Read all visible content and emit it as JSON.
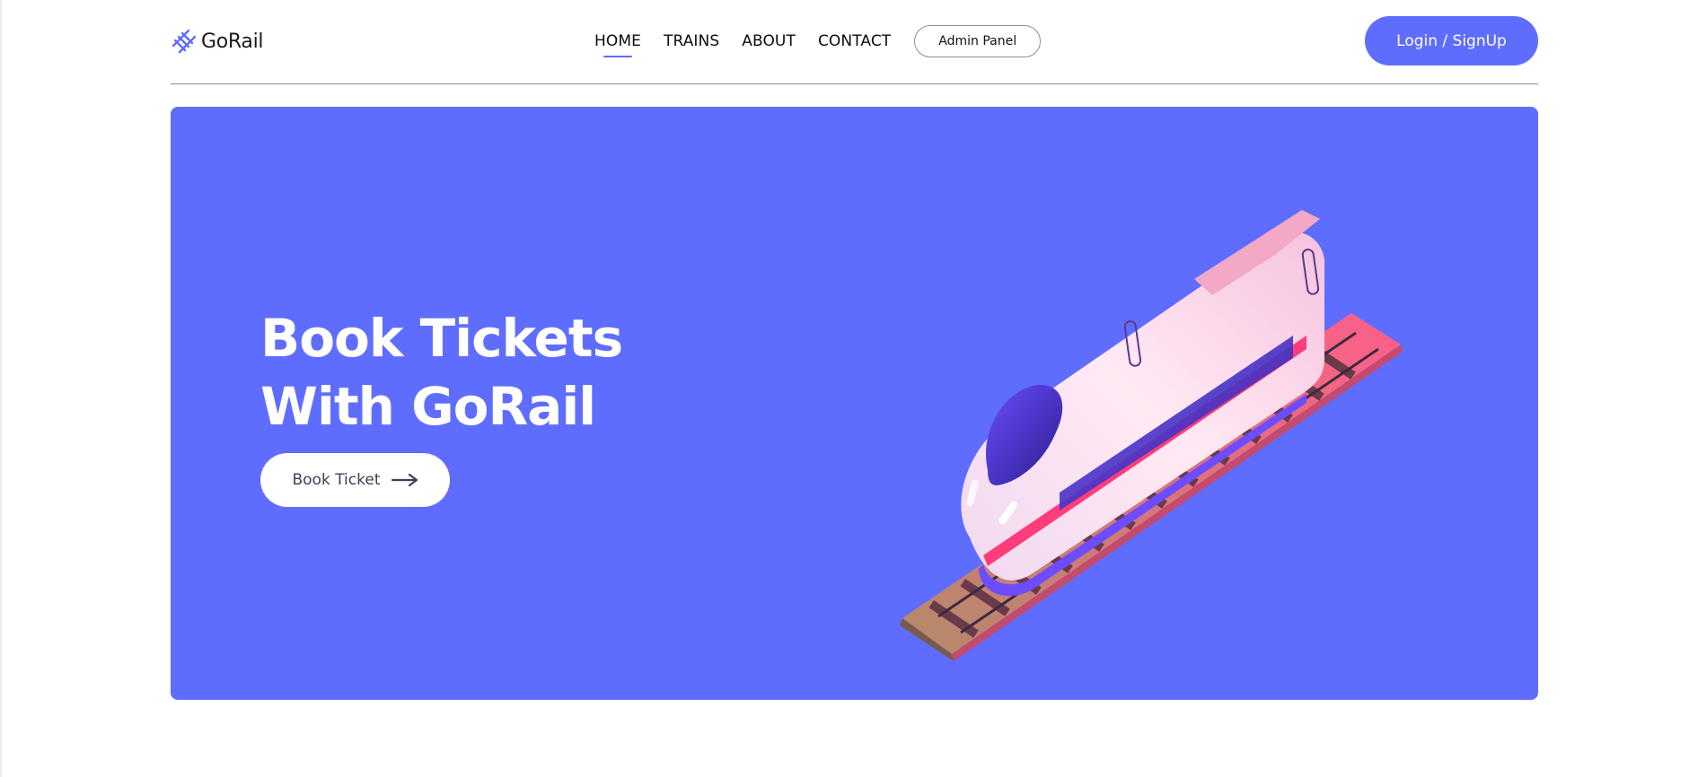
{
  "brand": {
    "name": "GoRail",
    "logo_icon": "railroad-track-icon"
  },
  "nav": {
    "items": [
      {
        "label": "HOME",
        "active": true
      },
      {
        "label": "TRAINS",
        "active": false
      },
      {
        "label": "ABOUT",
        "active": false
      },
      {
        "label": "CONTACT",
        "active": false
      }
    ],
    "admin_label": "Admin Panel"
  },
  "auth": {
    "login_label": "Login / SignUp"
  },
  "hero": {
    "title_line1": "Book Tickets",
    "title_line2": "With GoRail",
    "cta_label": "Book Ticket",
    "cta_icon": "arrow-right-icon",
    "illustration": "bullet-train-on-tracks-illustration"
  },
  "colors": {
    "accent": "#5f6dff",
    "text": "#0c0c0c",
    "button_text": "#3a3f57",
    "white": "#ffffff"
  }
}
